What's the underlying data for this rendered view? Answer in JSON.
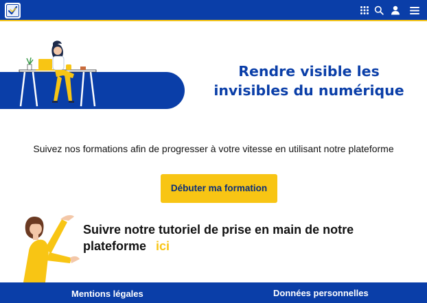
{
  "header": {
    "logo_icon": "check-shield-logo-icon",
    "icons": [
      "apps-grid-icon",
      "search-icon",
      "user-icon",
      "menu-icon"
    ],
    "bg_color": "#0a3ea8",
    "accent_color": "#f5c518"
  },
  "hero": {
    "title_line1": "Rendre visible les",
    "title_line2": "invisibles du numérique",
    "illustration": "woman-at-desk-laptop-illustration"
  },
  "intro": {
    "text": "Suivez nos formations afin de progresser à votre vitesse en utilisant notre plateforme"
  },
  "cta": {
    "label": "Débuter ma formation",
    "color": "#f8c514"
  },
  "tutorial": {
    "text": "Suivre notre tutoriel de prise en main de notre plateforme",
    "link_label": "ici",
    "illustration": "woman-presenting-illustration"
  },
  "footer": {
    "links": [
      "Mentions légales",
      "Données personnelles"
    ]
  }
}
